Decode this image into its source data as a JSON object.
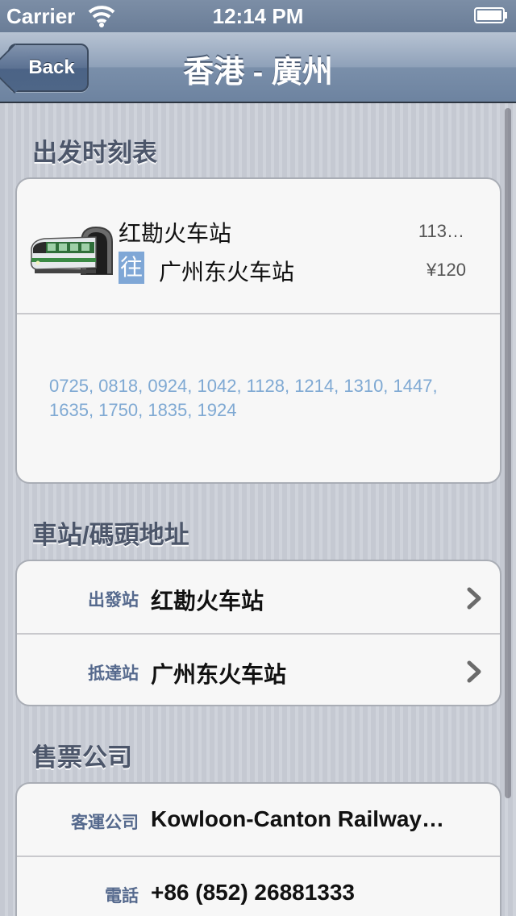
{
  "status_bar": {
    "carrier": "Carrier",
    "time": "12:14 PM"
  },
  "nav": {
    "back_label": "Back",
    "title": "香港 - 廣州"
  },
  "schedule": {
    "section_title": "出发时刻表",
    "from_station": "红勘火车站",
    "to_badge": "往",
    "to_station": "广州东火车站",
    "duration": "113…",
    "price": "¥120",
    "departures": "0725, 0818, 0924, 1042, 1128, 1214, 1310, 1447, 1635, 1750, 1835, 1924"
  },
  "address": {
    "section_title": "車站/碼頭地址",
    "rows": [
      {
        "label": "出發站",
        "value": "红勘火车站"
      },
      {
        "label": "抵達站",
        "value": "广州东火车站"
      }
    ]
  },
  "company": {
    "section_title": "售票公司",
    "rows": [
      {
        "label": "客運公司",
        "value": "Kowloon-Canton Railway…"
      },
      {
        "label": "電話",
        "value": "+86 (852) 26881333"
      }
    ]
  },
  "colors": {
    "nav_bar": "#7a8faa",
    "section_text": "#4c566a",
    "departure_text": "#7fa9d3",
    "row_label": "#55698d",
    "badge": "#7fa7d6"
  },
  "icons": [
    "wifi-icon",
    "battery-icon",
    "train-icon",
    "chevron-right-icon"
  ]
}
